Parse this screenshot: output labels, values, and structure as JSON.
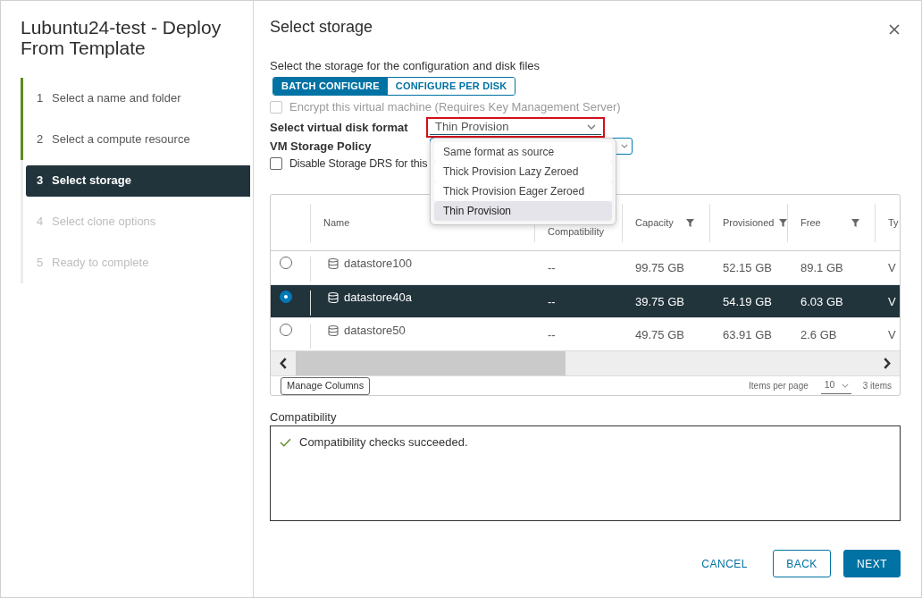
{
  "wizard": {
    "title": "Lubuntu24-test - Deploy From Template",
    "steps": [
      {
        "number": "1",
        "label": "Select a name and folder",
        "completed": true,
        "selected": false,
        "disabled": false
      },
      {
        "number": "2",
        "label": "Select a compute resource",
        "completed": true,
        "selected": false,
        "disabled": false
      },
      {
        "number": "3",
        "label": "Select storage",
        "completed": false,
        "selected": true,
        "disabled": false
      },
      {
        "number": "4",
        "label": "Select clone options",
        "completed": false,
        "selected": false,
        "disabled": true
      },
      {
        "number": "5",
        "label": "Ready to complete",
        "completed": false,
        "selected": false,
        "disabled": true
      }
    ]
  },
  "page": {
    "title": "Select storage",
    "instruction": "Select the storage for the configuration and disk files",
    "mode_tabs": [
      {
        "label": "BATCH CONFIGURE",
        "selected": true
      },
      {
        "label": "CONFIGURE PER DISK",
        "selected": false
      }
    ],
    "encrypt": {
      "label": "Encrypt this virtual machine (Requires Key Management Server)",
      "checked": false,
      "disabled": true
    },
    "disk_format": {
      "label": "Select virtual disk format",
      "value": "Thin Provision",
      "highlighted": true,
      "expanded": true,
      "options": [
        {
          "label": "Same format as source",
          "selected": false
        },
        {
          "label": "Thick Provision Lazy Zeroed",
          "selected": false
        },
        {
          "label": "Thick Provision Eager Zeroed",
          "selected": false
        },
        {
          "label": "Thin Provision",
          "selected": true
        }
      ]
    },
    "storage_policy": {
      "label": "VM Storage Policy"
    },
    "disable_drs": {
      "label": "Disable Storage DRS for this",
      "checked": false,
      "disabled": false
    },
    "table": {
      "columns": [
        {
          "label": "Name"
        },
        {
          "label": "Compatibility",
          "filter": false
        },
        {
          "label": "Capacity",
          "filter": true
        },
        {
          "label": "Provisioned",
          "filter": true
        },
        {
          "label": "Free",
          "filter": true
        },
        {
          "label": "Ty"
        }
      ],
      "rows": [
        {
          "selected": false,
          "cells": [
            "datastore100",
            "--",
            "99.75 GB",
            "52.15 GB",
            "89.1 GB",
            "V"
          ]
        },
        {
          "selected": true,
          "cells": [
            "datastore40a",
            "--",
            "39.75 GB",
            "54.19 GB",
            "6.03 GB",
            "V"
          ]
        },
        {
          "selected": false,
          "cells": [
            "datastore50",
            "--",
            "49.75 GB",
            "63.91 GB",
            "2.6 GB",
            "V"
          ]
        }
      ],
      "manage_columns": "Manage Columns",
      "items_per_page": {
        "label": "Items per page",
        "value": "10"
      },
      "count": "3 items"
    },
    "compatibility": {
      "label": "Compatibility",
      "passed": true,
      "message": "Compatibility checks succeeded."
    },
    "actions": [
      {
        "label": "CANCEL",
        "kind": "flat"
      },
      {
        "label": "BACK",
        "kind": "outline"
      },
      {
        "label": "NEXT",
        "kind": "primary"
      }
    ]
  }
}
